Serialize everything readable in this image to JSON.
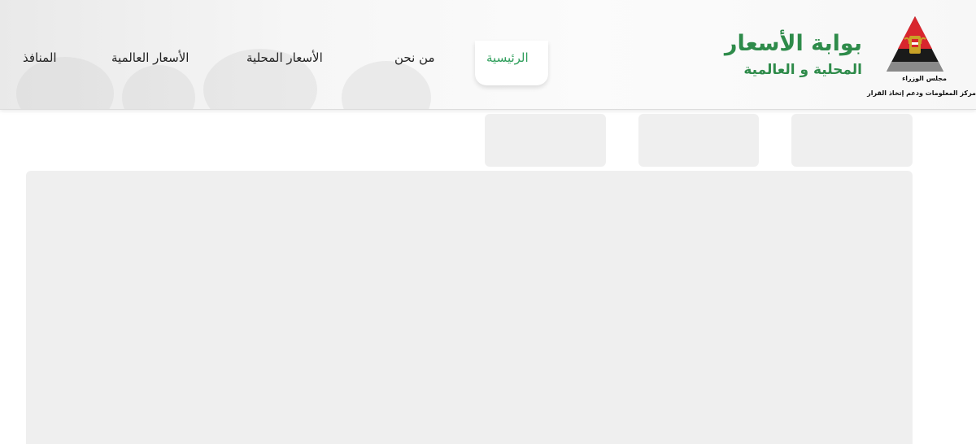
{
  "brand": {
    "title": "بوابة الأسعار",
    "subtitle": "المحلية و العالمية",
    "org_line1": "مجلس الوزراء",
    "org_line2": "مركز المعلومات ودعم إتخاذ القرار"
  },
  "nav": {
    "home": "الرئيسية",
    "about": "من نحن",
    "local_prices": "الأسعار المحلية",
    "global_prices": "الأسعار العالمية",
    "outlets": "المنافذ",
    "active_color": "#2e9e5b"
  },
  "colors": {
    "brand_green": "#2e8b4a",
    "skeleton": "#efefef"
  },
  "icons": {
    "logo": "egypt-cabinet-idsc-logo"
  }
}
